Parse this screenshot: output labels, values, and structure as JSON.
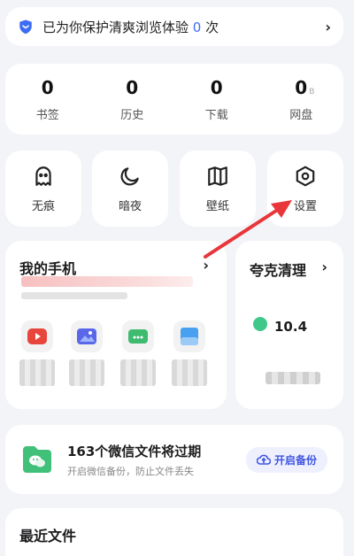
{
  "protect": {
    "prefix": "已为你保护清爽浏览体验",
    "count": "0",
    "suffix": "次"
  },
  "stats": [
    {
      "value": "0",
      "label": "书签",
      "unit": ""
    },
    {
      "value": "0",
      "label": "历史",
      "unit": ""
    },
    {
      "value": "0",
      "label": "下载",
      "unit": ""
    },
    {
      "value": "0",
      "label": "网盘",
      "unit": "B"
    }
  ],
  "tiles": [
    {
      "label": "无痕",
      "icon": "ghost-icon"
    },
    {
      "label": "暗夜",
      "icon": "moon-icon"
    },
    {
      "label": "壁纸",
      "icon": "book-icon"
    },
    {
      "label": "设置",
      "icon": "settings-hexagon-icon"
    }
  ],
  "phone": {
    "title": "我的手机",
    "apps": [
      {
        "icon": "video-icon",
        "color": "#e8453c"
      },
      {
        "icon": "image-icon",
        "color": "#5a67e8"
      },
      {
        "icon": "package-icon",
        "color": "#3dbb6f"
      },
      {
        "icon": "document-icon",
        "color": "#4aa0f0"
      }
    ]
  },
  "clean": {
    "title": "夸克清理",
    "value": "10.4",
    "accent": "#3ec98a"
  },
  "wechat": {
    "title": "163个微信文件将过期",
    "subtitle": "开启微信备份，防止文件丢失",
    "button": "开启备份"
  },
  "recent": {
    "title": "最近文件"
  },
  "colors": {
    "accent": "#3d6cf4",
    "annotation_arrow": "#e8363a"
  }
}
